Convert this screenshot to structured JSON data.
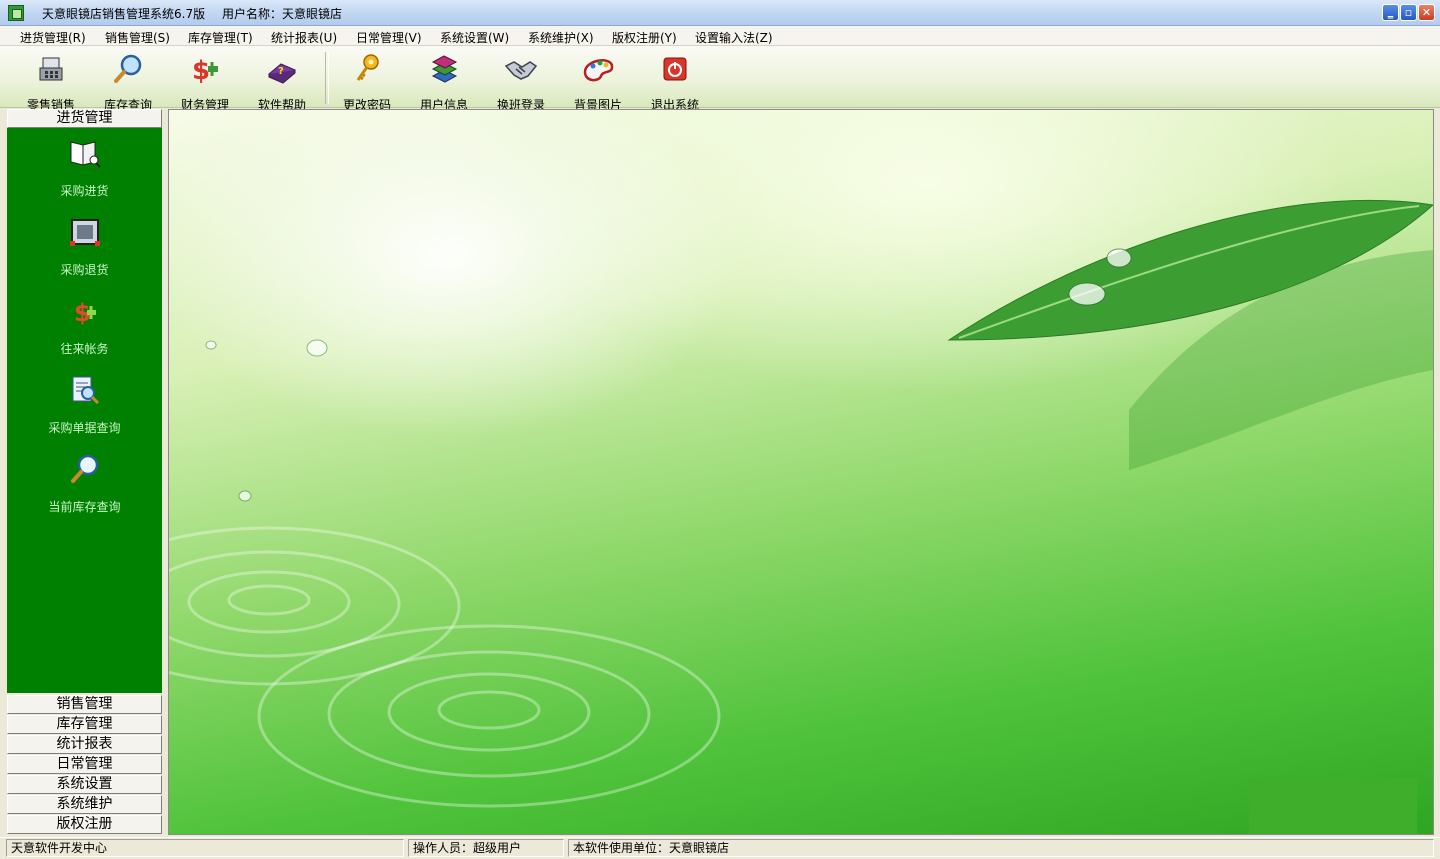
{
  "window": {
    "title": "天意眼镜店销售管理系统6.7版",
    "user_label": "用户名称：天意眼镜店",
    "min_glyph": "‗",
    "max_glyph": "▫",
    "close_glyph": "✕"
  },
  "menu": [
    {
      "label": "进货管理(R)"
    },
    {
      "label": "销售管理(S)"
    },
    {
      "label": "库存管理(T)"
    },
    {
      "label": "统计报表(U)"
    },
    {
      "label": "日常管理(V)"
    },
    {
      "label": "系统设置(W)"
    },
    {
      "label": "系统维护(X)"
    },
    {
      "label": "版权注册(Y)"
    },
    {
      "label": "设置输入法(Z)"
    }
  ],
  "toolbar": [
    {
      "label": "零售销售",
      "icon": "cashier-icon"
    },
    {
      "label": "库存查询",
      "icon": "magnifier-icon"
    },
    {
      "label": "财务管理",
      "icon": "dollar-icon"
    },
    {
      "label": "软件帮助",
      "icon": "help-book-icon"
    },
    {
      "label": "更改密码",
      "icon": "key-icon"
    },
    {
      "label": "用户信息",
      "icon": "books-icon"
    },
    {
      "label": "换班登录",
      "icon": "handshake-icon"
    },
    {
      "label": "背景图片",
      "icon": "palette-icon"
    },
    {
      "label": "退出系统",
      "icon": "power-icon"
    }
  ],
  "nav": {
    "active_group": "进货管理",
    "active_items": [
      {
        "label": "采购进货",
        "icon": "open-book-icon"
      },
      {
        "label": "采购退货",
        "icon": "return-frame-icon"
      },
      {
        "label": "往来帐务",
        "icon": "dollar-icon"
      },
      {
        "label": "采购单据查询",
        "icon": "document-search-icon"
      },
      {
        "label": "当前库存查询",
        "icon": "magnifier-icon"
      }
    ],
    "other_groups": [
      "销售管理",
      "库存管理",
      "统计报表",
      "日常管理",
      "系统设置",
      "系统维护",
      "版权注册"
    ]
  },
  "status": {
    "developer": "天意软件开发中心",
    "operator": "操作人员：超级用户",
    "licensee": "本软件使用单位：天意眼镜店"
  },
  "colors": {
    "nav_panel": "#008000",
    "nav_label": "#c8f5c8",
    "title_bar": "#c3d7f2"
  }
}
